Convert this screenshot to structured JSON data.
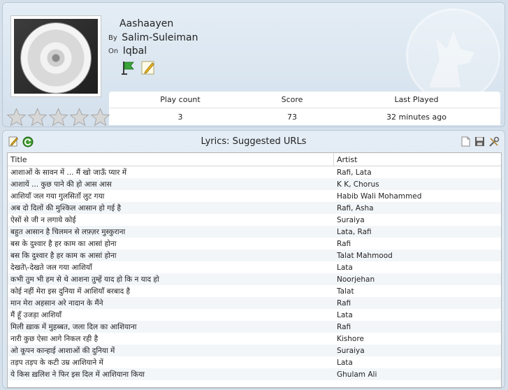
{
  "now_playing": {
    "title": "Aashaayen",
    "by_label": "By",
    "artist": "Salim-Suleiman",
    "on_label": "On",
    "album": "Iqbal",
    "icons": [
      "flag-icon",
      "edit-icon"
    ],
    "stats": {
      "headers": [
        "Play count",
        "Score",
        "Last Played"
      ],
      "values": [
        "3",
        "73",
        "32 minutes ago"
      ]
    },
    "rating": {
      "stars_total": 5,
      "stars_filled": 0
    }
  },
  "lyrics": {
    "title": "Lyrics: Suggested URLs",
    "toolbar_left": [
      "edit-icon",
      "refresh-icon"
    ],
    "toolbar_right": [
      "new-document-icon",
      "save-icon",
      "settings-icon"
    ],
    "columns": {
      "title": "Title",
      "artist": "Artist"
    },
    "rows": [
      {
        "title": "आशाओं के सावन में ... मैं खो जाऊँ प्यार में",
        "artist": "Rafi, Lata"
      },
      {
        "title": "आशायें ... कुछ पाने की हो आस आस",
        "artist": "K K, Chorus"
      },
      {
        "title": "आशियाँ जल गया गुलसिताँ लुट गया",
        "artist": "Habib Wali Mohammed"
      },
      {
        "title": "अब दो दिलों की मुश्किल आसान हो गई है",
        "artist": "Rafi, Asha"
      },
      {
        "title": "ऐसों से जी न लगाये कोई",
        "artist": "Suraiya"
      },
      {
        "title": "बहुत आसान है चिलमन से लफ़्ज़र मुस्कुराना",
        "artist": "Lata, Rafi"
      },
      {
        "title": "बस के दुश्वार है हर काम का आसां होना",
        "artist": "Rafi"
      },
      {
        "title": "बस कि दुश्वार है हर काम क आसां होना",
        "artist": "Talat Mahmood"
      },
      {
        "title": "देखते\\-देखते जल गया आशियाँ",
        "artist": "Lata"
      },
      {
        "title": "कभी तुम भी हम से थे आशना तुम्हें याद हो कि न याद हो",
        "artist": "Noorjehan"
      },
      {
        "title": "कोई नहीं मेरा इस दुनिया में आशियाँ बरबाद है",
        "artist": "Talat"
      },
      {
        "title": "मान मेरा अहसान अरे नादान के मैंने",
        "artist": "Rafi"
      },
      {
        "title": "मैं हूँ उजड़ा आशियाँ",
        "artist": "Lata"
      },
      {
        "title": "मिली ख़ाक में मुहब्बत, जला दिल का आशियाना",
        "artist": "Rafi"
      },
      {
        "title": "नारी कुछ ऐसा आगे निकल रही है",
        "artist": "Kishore"
      },
      {
        "title": "ओ कूपन कान्हाई आशाओं की दुनिया में",
        "artist": "Suraiya"
      },
      {
        "title": "तड़प तड़प के कटी उम्र आशियाने में",
        "artist": "Lata"
      },
      {
        "title": "ये किस ख़लिश ने फिर इस दिल में आशियाना किया",
        "artist": "Ghulam Ali"
      }
    ]
  }
}
